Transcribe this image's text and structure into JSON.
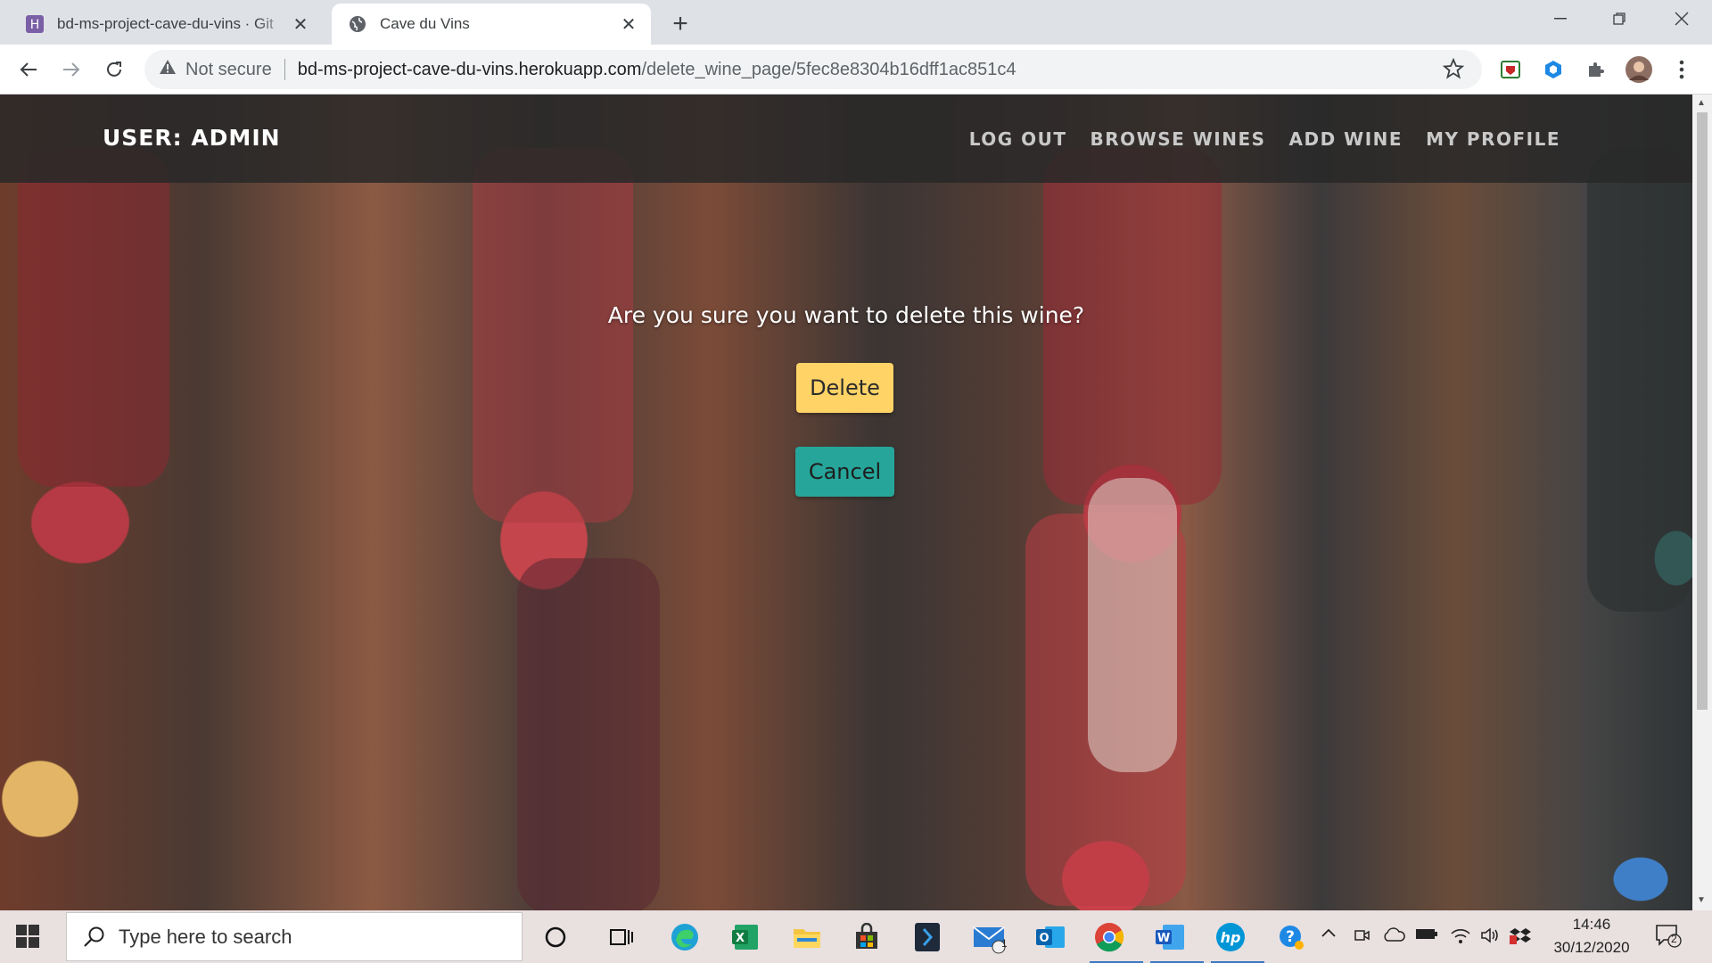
{
  "browser": {
    "tabs": [
      {
        "title": "bd-ms-project-cave-du-vins · Git",
        "icon": "heroku-icon"
      },
      {
        "title": "Cave du Vins",
        "icon": "globe-icon",
        "active": true
      }
    ],
    "security": "Not secure",
    "url_host": "bd-ms-project-cave-du-vins.herokuapp.com",
    "url_path": "/delete_wine_page/5fec8e8304b16dff1ac851c4"
  },
  "navbar": {
    "brand": "USER: ADMIN",
    "links": [
      "LOG OUT",
      "BROWSE WINES",
      "ADD WINE",
      "MY PROFILE"
    ]
  },
  "main": {
    "question": "Are you sure you want to delete this wine?",
    "delete_label": "Delete",
    "cancel_label": "Cancel",
    "delete_color": "#ffd366",
    "cancel_color": "#26a69a"
  },
  "taskbar": {
    "search_placeholder": "Type here to search",
    "time": "14:46",
    "date": "30/12/2020",
    "mail_badge": "1",
    "notification_badge": "2"
  }
}
